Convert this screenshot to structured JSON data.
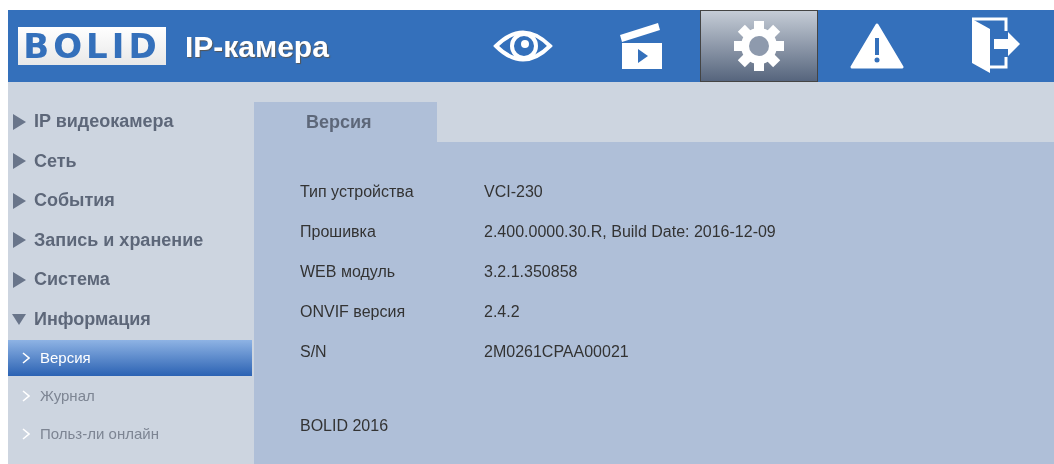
{
  "header": {
    "logo": "BOLID",
    "title": "IP-камера",
    "nav": [
      {
        "kind": "eye",
        "selected": false
      },
      {
        "kind": "clapper",
        "selected": false
      },
      {
        "kind": "gear",
        "selected": true
      },
      {
        "kind": "warning",
        "selected": false
      },
      {
        "kind": "exit",
        "selected": false
      }
    ]
  },
  "sidebar": {
    "items": [
      {
        "label": "IP видеокамера",
        "expanded": false
      },
      {
        "label": "Сеть",
        "expanded": false
      },
      {
        "label": "События",
        "expanded": false
      },
      {
        "label": "Запись и хранение",
        "expanded": false
      },
      {
        "label": "Система",
        "expanded": false
      },
      {
        "label": "Информация",
        "expanded": true,
        "children": [
          {
            "label": "Версия",
            "selected": true
          },
          {
            "label": "Журнал",
            "selected": false
          },
          {
            "label": "Польз-ли онлайн",
            "selected": false
          }
        ]
      }
    ]
  },
  "tabs": [
    {
      "label": "Версия",
      "selected": true
    }
  ],
  "info": [
    {
      "label": "Тип устройства",
      "value": "VCI-230"
    },
    {
      "label": "Прошивка",
      "value": "2.400.0000.30.R, Build Date: 2016-12-09"
    },
    {
      "label": "WEB модуль",
      "value": "3.2.1.350858"
    },
    {
      "label": "ONVIF версия",
      "value": "2.4.2"
    },
    {
      "label": "S/N",
      "value": "2M0261CPAA00021"
    }
  ],
  "footer": "BOLID 2016"
}
